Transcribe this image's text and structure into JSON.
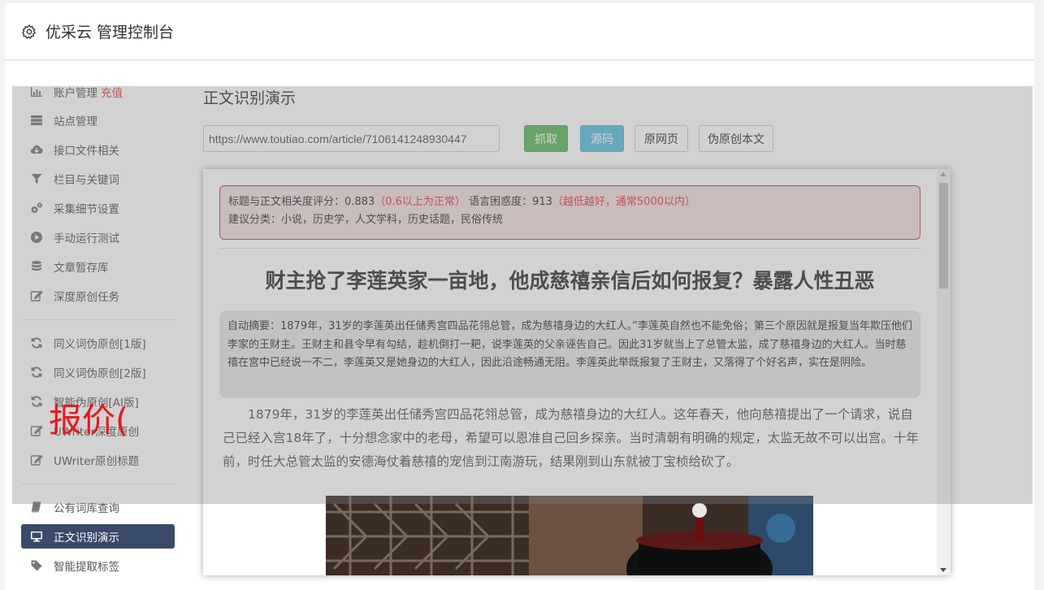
{
  "header": {
    "title": "优采云 管理控制台",
    "icon": "gear-icon"
  },
  "sidebar": {
    "group1": [
      {
        "label": "账户管理",
        "badge": "充值",
        "icon": "bar-chart-icon"
      },
      {
        "label": "站点管理",
        "icon": "server-icon"
      },
      {
        "label": "接口文件相关",
        "icon": "cloud-download-icon"
      },
      {
        "label": "栏目与关键词",
        "icon": "filter-icon"
      },
      {
        "label": "采集细节设置",
        "icon": "gears-icon"
      },
      {
        "label": "手动运行测试",
        "icon": "play-circle-icon"
      },
      {
        "label": "文章暂存库",
        "icon": "database-icon"
      },
      {
        "label": "深度原创任务",
        "icon": "edit-icon"
      }
    ],
    "group2": [
      {
        "label": "同义词伪原创[1版]",
        "icon": "refresh-icon"
      },
      {
        "label": "同义词伪原创[2版]",
        "icon": "refresh-icon"
      },
      {
        "label": "智能伪原创[AI版]",
        "icon": "refresh-icon"
      },
      {
        "label": "UWriter深度原创",
        "icon": "edit-icon"
      },
      {
        "label": "UWriter原创标题",
        "icon": "edit-icon"
      }
    ],
    "group3": [
      {
        "label": "公有词库查询",
        "icon": "book-icon"
      },
      {
        "label": "正文识别演示",
        "icon": "monitor-icon",
        "active": true
      },
      {
        "label": "智能提取标签",
        "icon": "tag-icon"
      }
    ]
  },
  "main": {
    "title": "正文识别演示",
    "url_value": "https://www.toutiao.com/article/7106141248930447",
    "btn_grab": "抓取",
    "btn_source": "源码",
    "btn_orig": "原网页",
    "btn_rewrite": "伪原创本文"
  },
  "article": {
    "score_label": "标题与正文相关度评分：",
    "score_value": "0.883",
    "score_note": "（0.6以上为正常）",
    "perplexity_label": "语言困惑度：",
    "perplexity_value": "913",
    "perplexity_note": "（越低越好，通常5000以内）",
    "category_line": "建议分类：小说，历史学，人文学科，历史话题，民俗传统",
    "title": "财主抢了李莲英家一亩地，他成慈禧亲信后如何报复？暴露人性丑恶",
    "summary": "自动摘要：1879年，31岁的李莲英出任储秀宫四品花翎总管，成为慈禧身边的大红人。”李莲英自然也不能免俗；第三个原因就是报复当年欺压他们李家的王财主。王财主和县令早有勾结，趁机倒打一耙，说李莲英的父亲诬告自己。因此31岁就当上了总管太监，成了慈禧身边的大红人。当时慈禧在宫中已经说一不二，李莲英又是她身边的大红人，因此沿途畅通无阻。李莲英此举既报复了王财主，又落得了个好名声，实在是阴险。",
    "paragraph": "1879年，31岁的李莲英出任储秀宫四品花翎总管，成为慈禧身边的大红人。这年春天，他向慈禧提出了一个请求，说自己已经入宫18年了，十分想念家中的老母，希望可以恩准自己回乡探亲。当时清朝有明确的规定，太监无故不可以出宫。十年前，时任大总管太监的安德海仗着慈禧的宠信到江南游玩，结果刚到山东就被丁宝桢给砍了。"
  },
  "overlay": {
    "text": "报价("
  }
}
